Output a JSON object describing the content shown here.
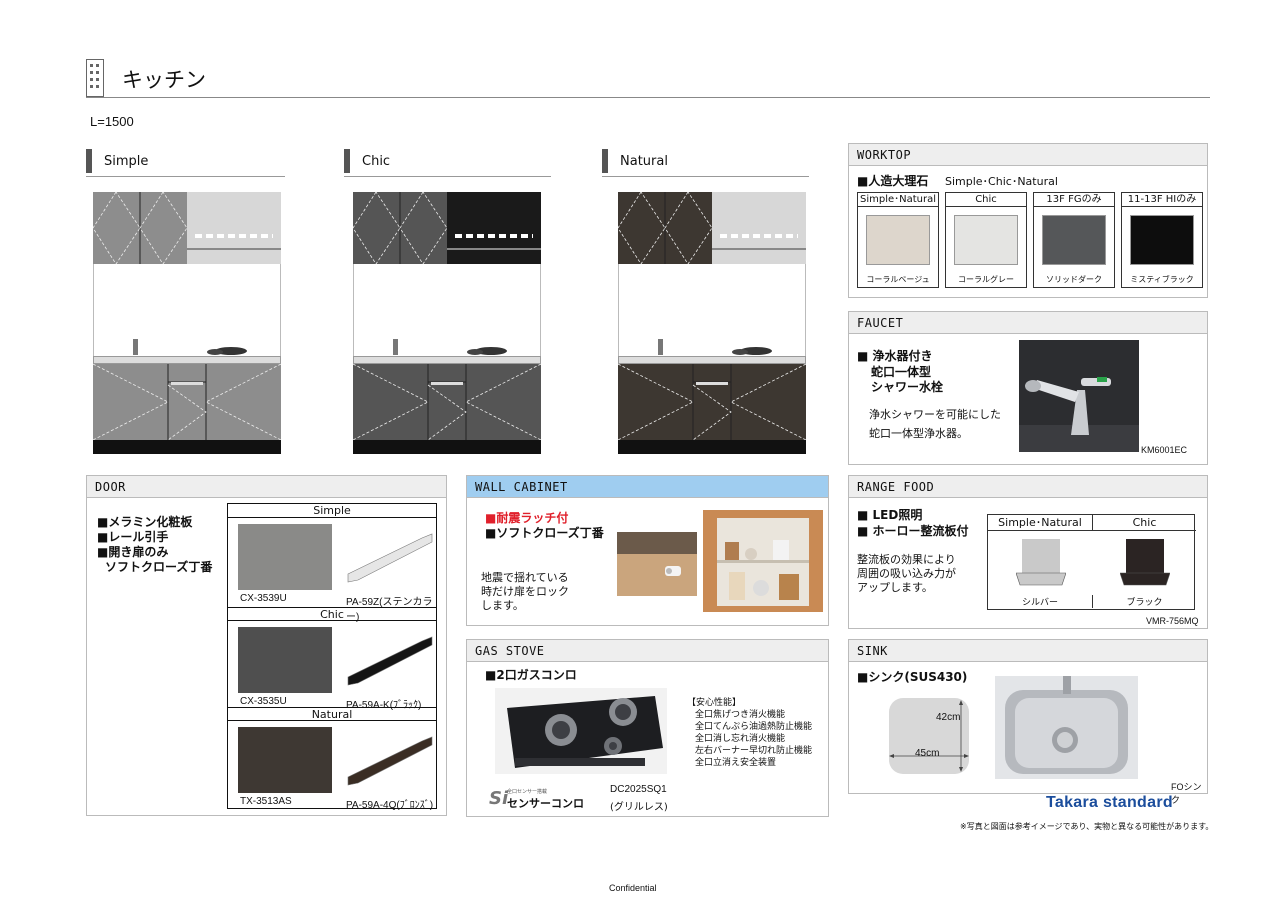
{
  "page": {
    "title": "キッチン",
    "length": "L=1500",
    "confidential": "Confidential",
    "note": "※写真と図面は参考イメージであり、実物と異なる可能性があります。",
    "brand": "Takara standard"
  },
  "styles": {
    "simple": {
      "label": "Simple",
      "door_color": "#8d8d8d",
      "wall_color": "#d7d7d7"
    },
    "chic": {
      "label": "Chic",
      "door_color": "#555555",
      "wall_color": "#1a1a1a"
    },
    "natural": {
      "label": "Natural",
      "door_color": "#3d3731",
      "wall_color": "#d7d7d7"
    }
  },
  "worktop": {
    "header": "WORKTOP",
    "heading": "■人造大理石",
    "heading_sub": "Simple･Chic･Natural",
    "swatches": [
      {
        "head": "Simple･Natural",
        "label": "コーラルベージュ",
        "color": "#ddd6cc"
      },
      {
        "head": "Chic",
        "label": "コーラルグレー",
        "color": "#e4e4e2"
      },
      {
        "head": "13F  FGのみ",
        "label": "ソリッドダーク",
        "color": "#555759"
      },
      {
        "head": "11-13F  HIのみ",
        "label": "ミスティブラック",
        "color": "#0d0d0d"
      }
    ]
  },
  "faucet": {
    "header": "FAUCET",
    "lines": [
      "■ 浄水器付き",
      "蛇口一体型",
      "シャワー水栓"
    ],
    "desc": [
      "浄水シャワーを可能にした",
      "蛇口一体型浄水器。"
    ],
    "model": "KM6001EC"
  },
  "door": {
    "header": "DOOR",
    "features": [
      "■メラミン化粧板",
      "■レール引手",
      "■開き扉のみ",
      "ソフトクローズ丁番"
    ],
    "sections": [
      {
        "title": "Simple",
        "panel": "CX-3539U",
        "handle": "PA-59Z(ステンカラー)",
        "panel_color": "#8a8a88",
        "handle_color": "#e6e6e6"
      },
      {
        "title": "Chic",
        "panel": "CX-3535U",
        "handle": "PA-59A-K(ﾌﾞﾗｯｸ)",
        "panel_color": "#4f4f4f",
        "handle_color": "#151515"
      },
      {
        "title": "Natural",
        "panel": "TX-3513AS",
        "handle": "PA-59A-4Q(ﾌﾞﾛﾝｽﾞ)",
        "panel_color": "#3e3833",
        "handle_color": "#3a2d24"
      }
    ]
  },
  "wall_cabinet": {
    "header": "WALL CABINET",
    "line1": "■耐震ラッチ付",
    "line2": "■ソフトクローズ丁番",
    "desc": [
      "地震で揺れている",
      "時だけ扉をロック",
      "します。"
    ]
  },
  "gas_stove": {
    "header": "GAS STOVE",
    "heading": "■2口ガスコンロ",
    "safety_title": "【安心性能】",
    "safety": [
      "全口焦げつき消火機能",
      "全口てんぷら油過熱防止機能",
      "全口消し忘れ消火機能",
      "左右バーナー早切れ防止機能",
      "全口立消え安全装置"
    ],
    "badge_small": "全口センサー搭載",
    "badge": "センサーコンロ",
    "model": "DC2025SQ1",
    "model_note": "(グリルレス)"
  },
  "range_hood": {
    "header": "RANGE FOOD",
    "lines": [
      "■ LED照明",
      "■ ホーロー整流板付"
    ],
    "desc": [
      "整流板の効果により",
      "周囲の吸い込み力が",
      "アップします。"
    ],
    "options": [
      {
        "head": "Simple･Natural",
        "label": "シルバー",
        "color": "#c9c9c9"
      },
      {
        "head": "Chic",
        "label": "ブラック",
        "color": "#2b2423"
      }
    ],
    "model": "VMR-756MQ"
  },
  "sink": {
    "header": "SINK",
    "heading": "■シンク(SUS430)",
    "depth": "42cm",
    "width": "45cm",
    "model": "FOシンク"
  }
}
